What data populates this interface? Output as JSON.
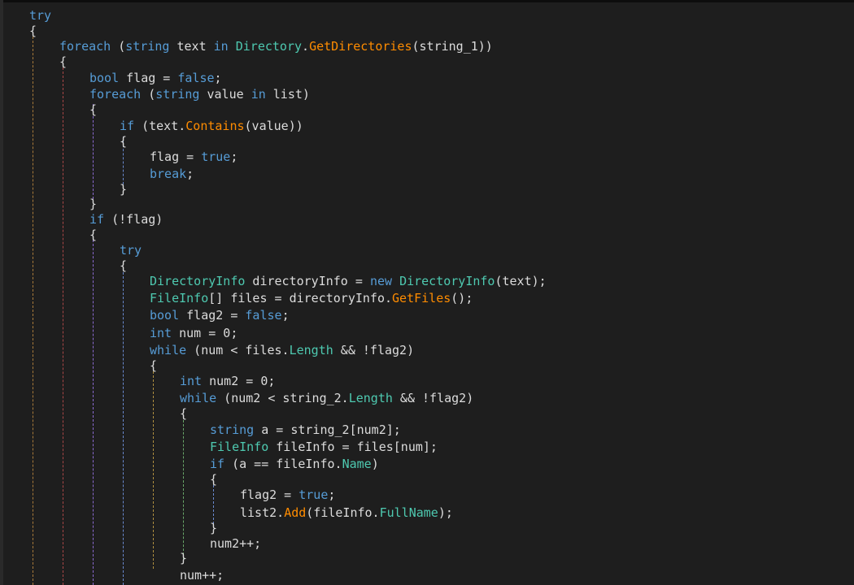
{
  "colors": {
    "background": "#1e1e1e",
    "keyword": "#569cd6",
    "type": "#4ec9b0",
    "method": "#ff8c00",
    "plain": "#dcdcdc"
  },
  "code": {
    "lines": [
      [
        {
          "t": "try",
          "c": "kw"
        }
      ],
      [
        {
          "t": "{",
          "c": "p"
        }
      ],
      [
        {
          "t": "foreach",
          "c": "kw"
        },
        {
          "t": " (",
          "c": "p"
        },
        {
          "t": "string",
          "c": "kw"
        },
        {
          "t": " text ",
          "c": "p"
        },
        {
          "t": "in",
          "c": "kw"
        },
        {
          "t": " ",
          "c": "p"
        },
        {
          "t": "Directory",
          "c": "cls"
        },
        {
          "t": ".",
          "c": "p"
        },
        {
          "t": "GetDirectories",
          "c": "mth"
        },
        {
          "t": "(string_1))",
          "c": "p"
        }
      ],
      [
        {
          "t": "{",
          "c": "p"
        }
      ],
      [
        {
          "t": "bool",
          "c": "kw"
        },
        {
          "t": " flag = ",
          "c": "p"
        },
        {
          "t": "false",
          "c": "kw"
        },
        {
          "t": ";",
          "c": "p"
        }
      ],
      [
        {
          "t": "foreach",
          "c": "kw"
        },
        {
          "t": " (",
          "c": "p"
        },
        {
          "t": "string",
          "c": "kw"
        },
        {
          "t": " value ",
          "c": "p"
        },
        {
          "t": "in",
          "c": "kw"
        },
        {
          "t": " list)",
          "c": "p"
        }
      ],
      [
        {
          "t": "{",
          "c": "p"
        }
      ],
      [
        {
          "t": "if",
          "c": "kw"
        },
        {
          "t": " (text.",
          "c": "p"
        },
        {
          "t": "Contains",
          "c": "mth"
        },
        {
          "t": "(value))",
          "c": "p"
        }
      ],
      [
        {
          "t": "{",
          "c": "p"
        }
      ],
      [
        {
          "t": "flag = ",
          "c": "p"
        },
        {
          "t": "true",
          "c": "kw"
        },
        {
          "t": ";",
          "c": "p"
        }
      ],
      [
        {
          "t": "break",
          "c": "kw"
        },
        {
          "t": ";",
          "c": "p"
        }
      ],
      [
        {
          "t": "}",
          "c": "p"
        }
      ],
      [
        {
          "t": "}",
          "c": "p"
        }
      ],
      [
        {
          "t": "if",
          "c": "kw"
        },
        {
          "t": " (!flag)",
          "c": "p"
        }
      ],
      [
        {
          "t": "{",
          "c": "p"
        }
      ],
      [
        {
          "t": "try",
          "c": "kw"
        }
      ],
      [
        {
          "t": "{",
          "c": "p"
        }
      ],
      [
        {
          "t": "DirectoryInfo",
          "c": "cls"
        },
        {
          "t": " directoryInfo = ",
          "c": "p"
        },
        {
          "t": "new",
          "c": "kw"
        },
        {
          "t": " ",
          "c": "p"
        },
        {
          "t": "DirectoryInfo",
          "c": "cls"
        },
        {
          "t": "(text);",
          "c": "p"
        }
      ],
      [
        {
          "t": "FileInfo",
          "c": "cls"
        },
        {
          "t": "[] files = directoryInfo.",
          "c": "p"
        },
        {
          "t": "GetFiles",
          "c": "mth"
        },
        {
          "t": "();",
          "c": "p"
        }
      ],
      [
        {
          "t": "bool",
          "c": "kw"
        },
        {
          "t": " flag2 = ",
          "c": "p"
        },
        {
          "t": "false",
          "c": "kw"
        },
        {
          "t": ";",
          "c": "p"
        }
      ],
      [
        {
          "t": "int",
          "c": "kw"
        },
        {
          "t": " num = 0;",
          "c": "p"
        }
      ],
      [
        {
          "t": "while",
          "c": "kw"
        },
        {
          "t": " (num < files.",
          "c": "p"
        },
        {
          "t": "Length",
          "c": "prop"
        },
        {
          "t": " && !flag2)",
          "c": "p"
        }
      ],
      [
        {
          "t": "{",
          "c": "p"
        }
      ],
      [
        {
          "t": "int",
          "c": "kw"
        },
        {
          "t": " num2 = 0;",
          "c": "p"
        }
      ],
      [
        {
          "t": "while",
          "c": "kw"
        },
        {
          "t": " (num2 < string_2.",
          "c": "p"
        },
        {
          "t": "Length",
          "c": "prop"
        },
        {
          "t": " && !flag2)",
          "c": "p"
        }
      ],
      [
        {
          "t": "{",
          "c": "p"
        }
      ],
      [
        {
          "t": "string",
          "c": "kw"
        },
        {
          "t": " a = string_2[num2];",
          "c": "p"
        }
      ],
      [
        {
          "t": "FileInfo",
          "c": "cls"
        },
        {
          "t": " fileInfo = files[num];",
          "c": "p"
        }
      ],
      [
        {
          "t": "if",
          "c": "kw"
        },
        {
          "t": " (a == fileInfo.",
          "c": "p"
        },
        {
          "t": "Name",
          "c": "prop"
        },
        {
          "t": ")",
          "c": "p"
        }
      ],
      [
        {
          "t": "{",
          "c": "p"
        }
      ],
      [
        {
          "t": "flag2 = ",
          "c": "p"
        },
        {
          "t": "true",
          "c": "kw"
        },
        {
          "t": ";",
          "c": "p"
        }
      ],
      [
        {
          "t": "list2.",
          "c": "p"
        },
        {
          "t": "Add",
          "c": "mth"
        },
        {
          "t": "(fileInfo.",
          "c": "p"
        },
        {
          "t": "FullName",
          "c": "prop"
        },
        {
          "t": ");",
          "c": "p"
        }
      ],
      [
        {
          "t": "}",
          "c": "p"
        }
      ],
      [
        {
          "t": "num2++;",
          "c": "p"
        }
      ],
      [
        {
          "t": "}",
          "c": "p"
        }
      ],
      [
        {
          "t": "num++;",
          "c": "p"
        }
      ]
    ]
  }
}
